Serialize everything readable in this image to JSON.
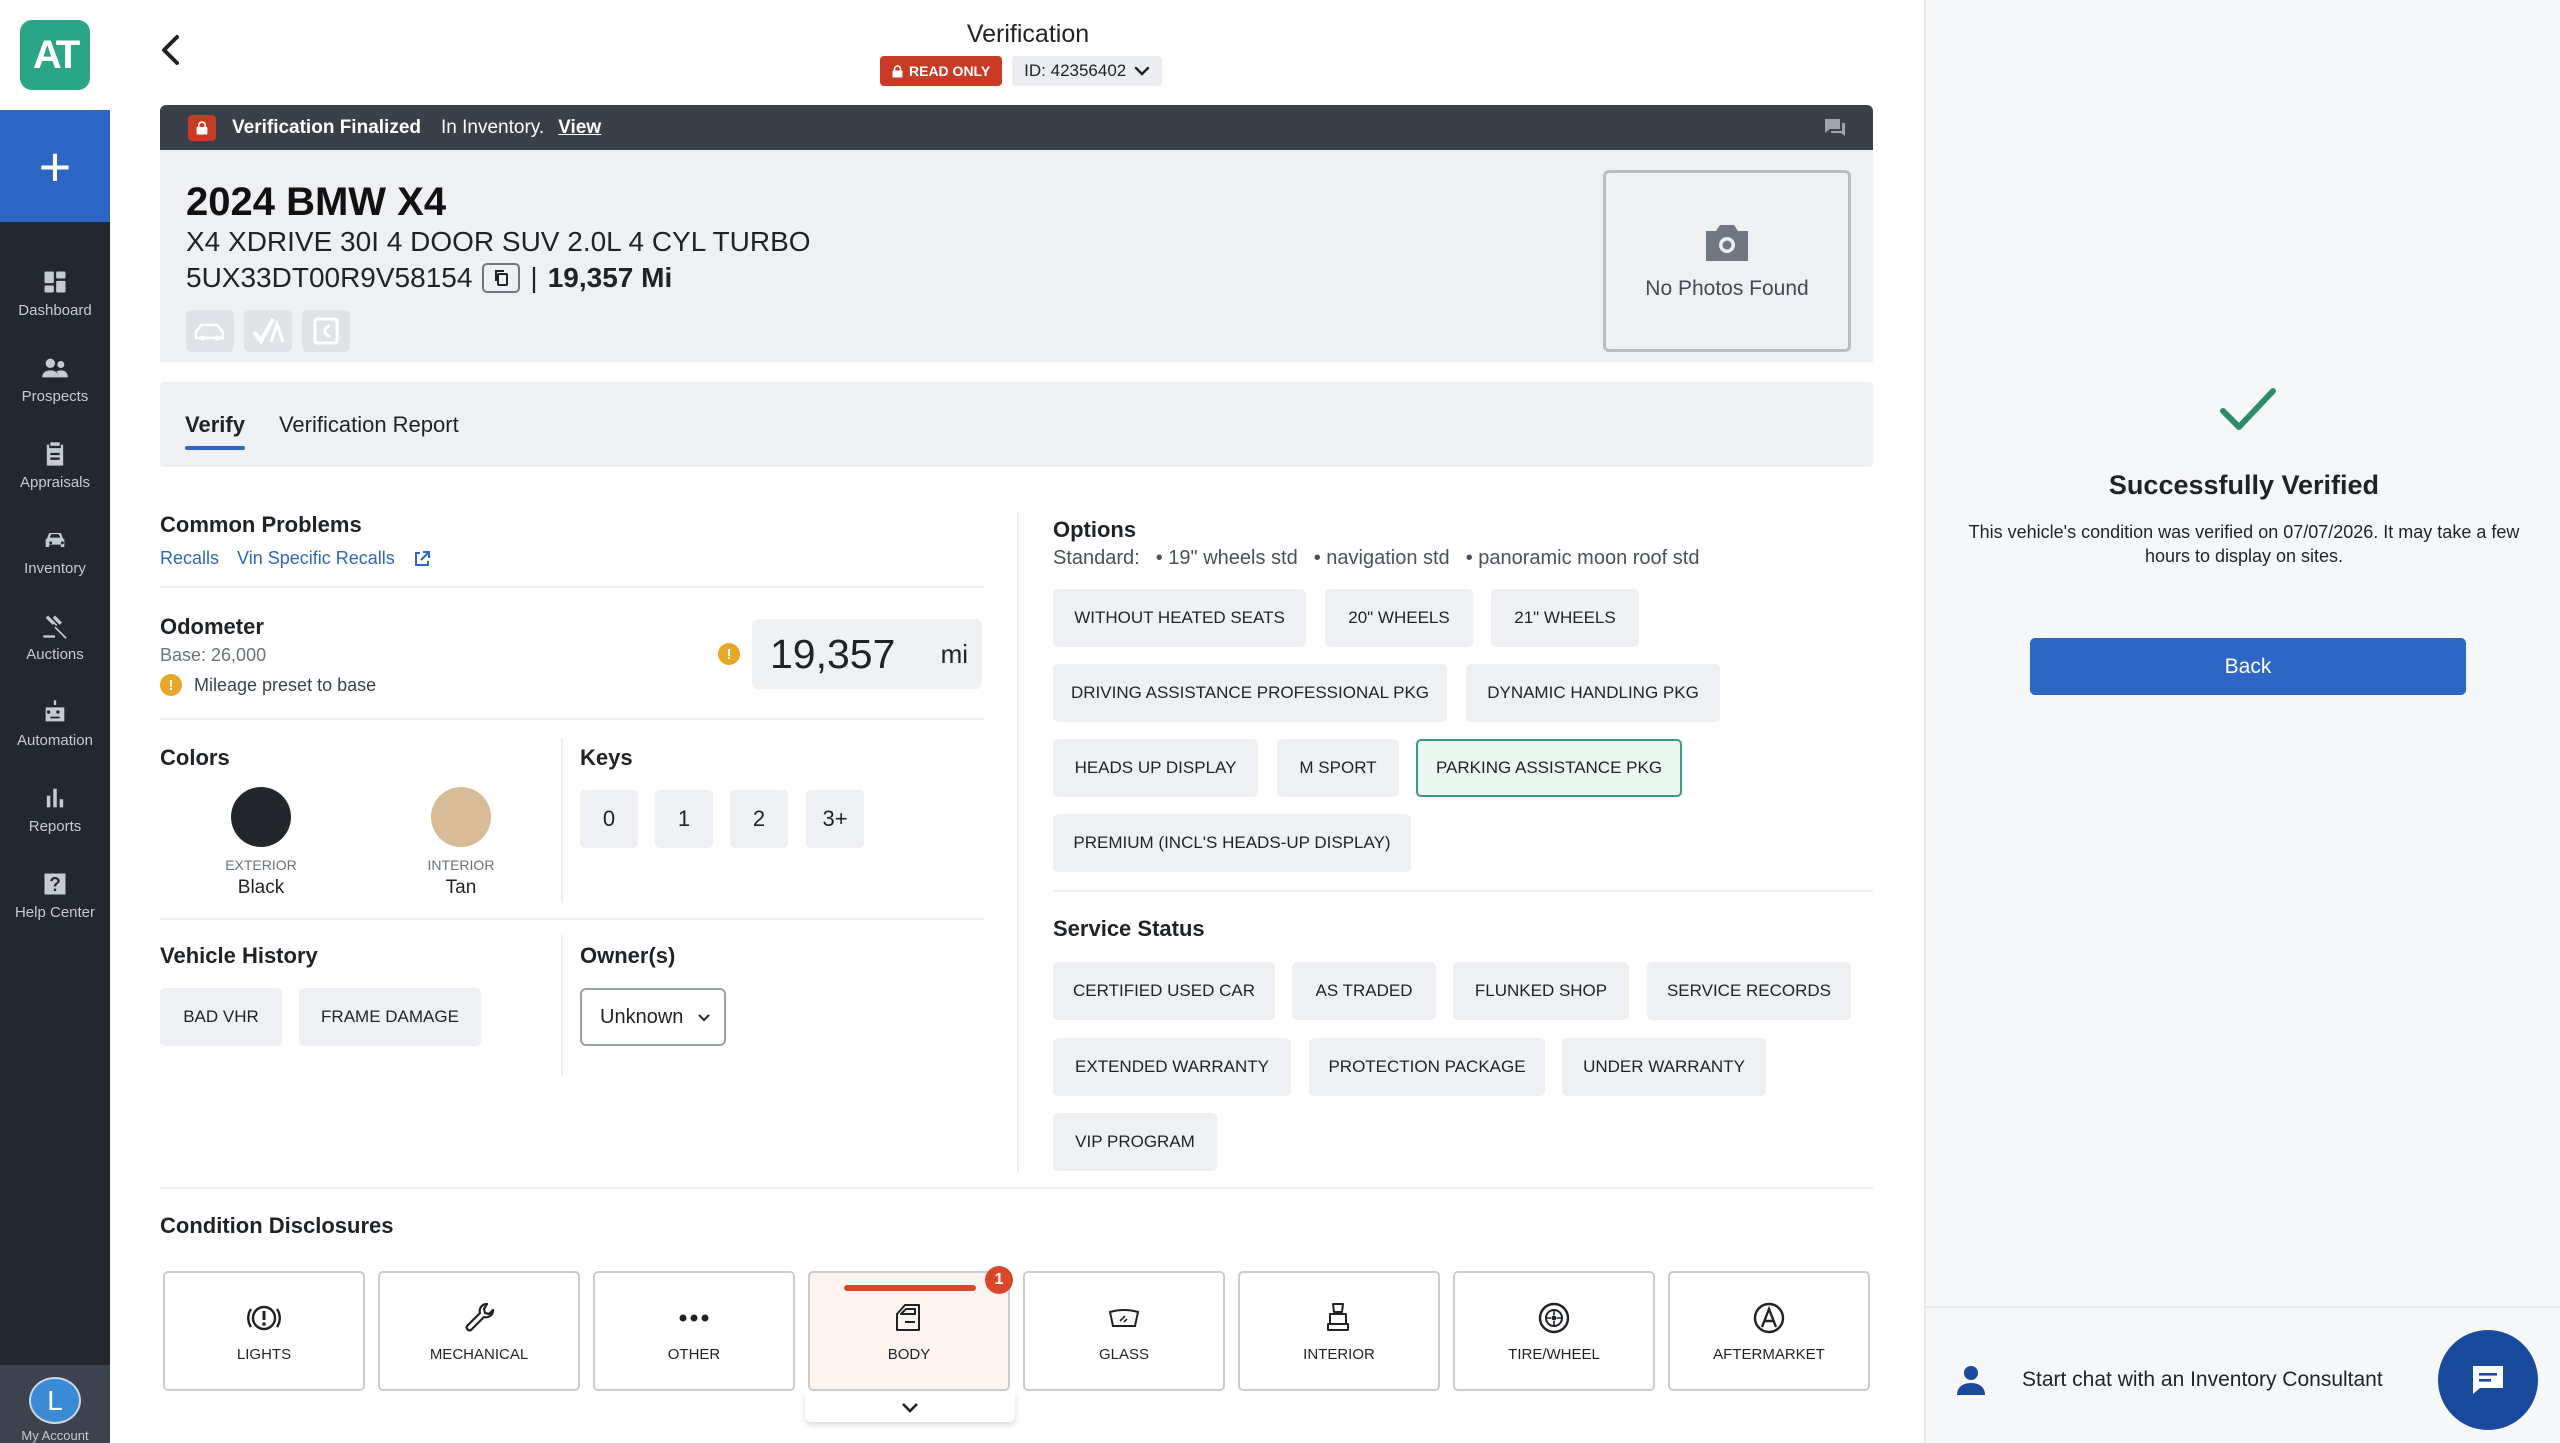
{
  "sidebar": {
    "logo_text": "AT",
    "add_label": "+",
    "items": [
      {
        "label": "Dashboard",
        "icon": "dashboard-icon"
      },
      {
        "label": "Prospects",
        "icon": "people-icon"
      },
      {
        "label": "Appraisals",
        "icon": "clipboard-icon"
      },
      {
        "label": "Inventory",
        "icon": "car-icon"
      },
      {
        "label": "Auctions",
        "icon": "gavel-icon"
      },
      {
        "label": "Automation",
        "icon": "robot-icon"
      },
      {
        "label": "Reports",
        "icon": "bar-chart-icon"
      },
      {
        "label": "Help Center",
        "icon": "help-icon"
      }
    ],
    "account": {
      "initial": "L",
      "label": "My Account"
    }
  },
  "header": {
    "title": "Verification",
    "read_only": "READ ONLY",
    "id_label": "ID: 42356402"
  },
  "status_bar": {
    "finalized": "Verification Finalized",
    "inventory": "In Inventory.",
    "view": "View"
  },
  "vehicle": {
    "year_model": "2024 BMW X4",
    "trim": "X4 XDRIVE 30I 4 DOOR SUV 2.0L 4 CYL TURBO",
    "vin": "5UX33DT00R9V58154",
    "separator": "|",
    "miles": "19,357 Mi",
    "photo_text": "No Photos Found"
  },
  "tabs": [
    {
      "label": "Verify",
      "active": true
    },
    {
      "label": "Verification Report",
      "active": false
    }
  ],
  "common_problems": {
    "title": "Common Problems",
    "recalls": "Recalls",
    "vin_recalls": "Vin Specific Recalls"
  },
  "odometer": {
    "title": "Odometer",
    "base": "Base: 26,000",
    "preset_note": "Mileage preset to base",
    "value": "19,357",
    "unit": "mi"
  },
  "colors": {
    "title": "Colors",
    "exterior_label": "EXTERIOR",
    "exterior_value": "Black",
    "exterior_hex": "#23262a",
    "interior_label": "INTERIOR",
    "interior_value": "Tan",
    "interior_hex": "#d8bc97"
  },
  "keys": {
    "title": "Keys",
    "options": [
      "0",
      "1",
      "2",
      "3+"
    ]
  },
  "vehicle_history": {
    "title": "Vehicle History",
    "options": [
      "BAD VHR",
      "FRAME DAMAGE"
    ]
  },
  "owners": {
    "title": "Owner(s)",
    "selected": "Unknown"
  },
  "options": {
    "title": "Options",
    "standard_label": "Standard:",
    "standard_items": [
      "19\" wheels std",
      "navigation std",
      "panoramic moon roof std"
    ],
    "chips": [
      {
        "label": "WITHOUT HEATED SEATS",
        "selected": false
      },
      {
        "label": "20\" WHEELS",
        "selected": false
      },
      {
        "label": "21\" WHEELS",
        "selected": false
      },
      {
        "label": "DRIVING ASSISTANCE PROFESSIONAL PKG",
        "selected": false
      },
      {
        "label": "DYNAMIC HANDLING PKG",
        "selected": false
      },
      {
        "label": "HEADS UP DISPLAY",
        "selected": false
      },
      {
        "label": "M SPORT",
        "selected": false
      },
      {
        "label": "PARKING ASSISTANCE PKG",
        "selected": true
      },
      {
        "label": "PREMIUM (INCL'S HEADS-UP DISPLAY)",
        "selected": false
      }
    ]
  },
  "service_status": {
    "title": "Service Status",
    "chips": [
      "CERTIFIED USED CAR",
      "AS TRADED",
      "FLUNKED SHOP",
      "SERVICE RECORDS",
      "EXTENDED WARRANTY",
      "PROTECTION PACKAGE",
      "UNDER WARRANTY",
      "VIP PROGRAM"
    ]
  },
  "condition": {
    "title": "Condition Disclosures",
    "cards": [
      {
        "label": "LIGHTS",
        "icon": "lights-icon"
      },
      {
        "label": "MECHANICAL",
        "icon": "wrench-icon"
      },
      {
        "label": "OTHER",
        "icon": "more-icon"
      },
      {
        "label": "BODY",
        "icon": "car-body-icon",
        "badge": "1",
        "active": true
      },
      {
        "label": "GLASS",
        "icon": "windshield-icon"
      },
      {
        "label": "INTERIOR",
        "icon": "seat-icon"
      },
      {
        "label": "TIRE/WHEEL",
        "icon": "tire-icon"
      },
      {
        "label": "AFTERMARKET",
        "icon": "aftermarket-icon"
      }
    ]
  },
  "right_panel": {
    "title": "Successfully Verified",
    "message": "This vehicle's condition was verified on 07/07/2026. It may take a few hours to display on sites.",
    "back_label": "Back",
    "chat_label": "Start chat with an Inventory Consultant"
  },
  "colors_theme": {
    "brand_green": "#2aa588",
    "primary_blue": "#2d66c4",
    "danger_red": "#c83b26",
    "success_green": "#2e8c6a"
  }
}
